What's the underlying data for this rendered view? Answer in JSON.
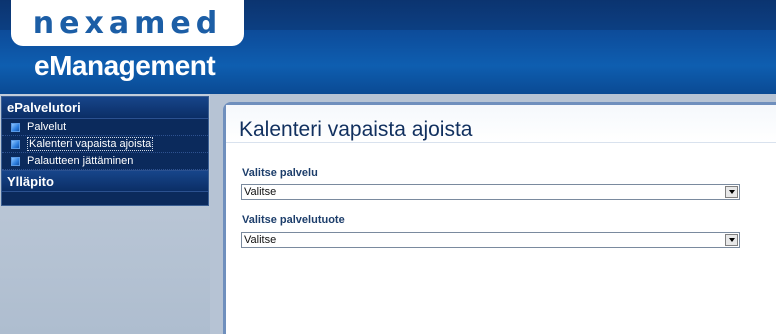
{
  "header": {
    "logo_text": "nexamed",
    "app_title": "eManagement"
  },
  "sidebar": {
    "sections": [
      {
        "title": "ePalvelutori",
        "items": [
          {
            "label": "Palvelut"
          },
          {
            "label": "Kalenteri vapaista ajoista"
          },
          {
            "label": "Palautteen jättäminen"
          }
        ]
      },
      {
        "title": "Ylläpito",
        "items": []
      }
    ]
  },
  "main": {
    "title": "Kalenteri vapaista ajoista",
    "fields": [
      {
        "label": "Valitse palvelu",
        "value": "Valitse"
      },
      {
        "label": "Valitse palvelutuote",
        "value": "Valitse"
      }
    ]
  },
  "colors": {
    "header_blue": "#0e5eb0",
    "nav_dark": "#0b2a5c",
    "title_text": "#11305f"
  }
}
